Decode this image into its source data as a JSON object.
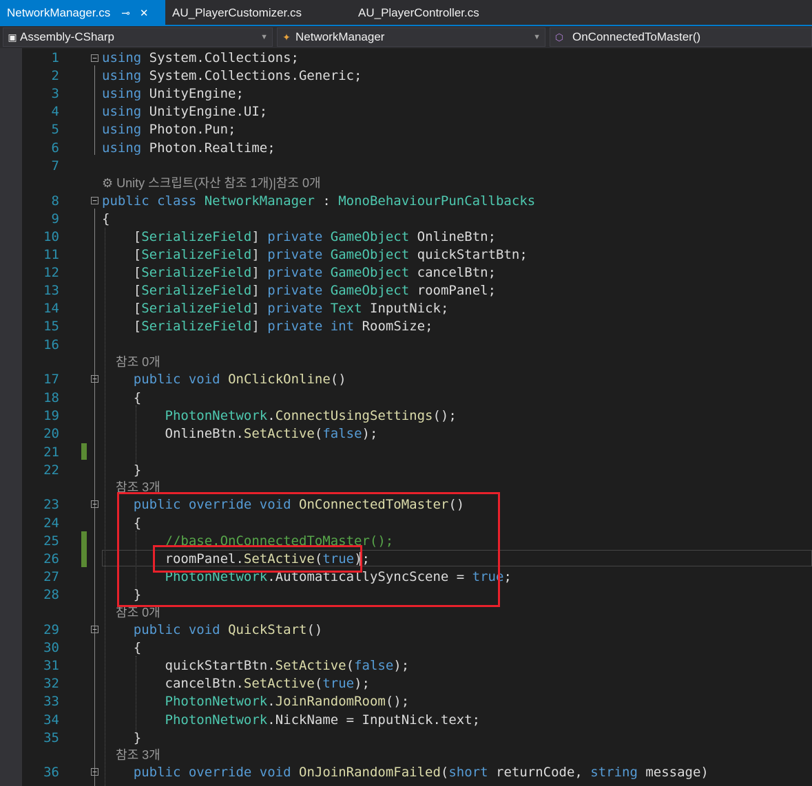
{
  "tabs": [
    {
      "label": "NetworkManager.cs",
      "active": true,
      "pin_icon": "pin-icon",
      "close_icon": "close-icon"
    },
    {
      "label": "AU_PlayerCustomizer.cs",
      "active": false
    },
    {
      "label": "AU_PlayerController.cs",
      "active": false
    }
  ],
  "navbar": {
    "project": {
      "label": "Assembly-CSharp",
      "icon": "csharp-project-icon"
    },
    "type": {
      "label": "NetworkManager",
      "icon": "class-icon"
    },
    "member": {
      "label": "OnConnectedToMaster()",
      "icon": "method-icon"
    }
  },
  "colors": {
    "background": "#1e1e1e",
    "keyword": "#569cd6",
    "type": "#4ec9b0",
    "method": "#dcdcaa",
    "comment": "#57a64a",
    "line_number": "#2b91af",
    "highlight_box": "#e8212b",
    "change_marker": "#5a8a33",
    "tab_active": "#007acc"
  },
  "code": {
    "l1": {
      "n": "1",
      "kw": "using",
      "rest": " System.Collections;"
    },
    "l2": {
      "n": "2",
      "kw": "using",
      "rest": " System.Collections.Generic;"
    },
    "l3": {
      "n": "3",
      "kw": "using",
      "rest": " UnityEngine;"
    },
    "l4": {
      "n": "4",
      "kw": "using",
      "rest": " UnityEngine.UI;"
    },
    "l5": {
      "n": "5",
      "kw": "using",
      "rest": " Photon.Pun;"
    },
    "l6": {
      "n": "6",
      "kw": "using",
      "rest": " Photon.Realtime;"
    },
    "l7": {
      "n": "7"
    },
    "lens8": {
      "icon": "unity-icon",
      "text": "Unity 스크립트(자산 참조 1개)|참조 0개"
    },
    "l8": {
      "n": "8",
      "kw": "public class",
      "name": "NetworkManager",
      "sep": " : ",
      "base": "MonoBehaviourPunCallbacks"
    },
    "l9": {
      "n": "9",
      "text": "{"
    },
    "l10": {
      "n": "10",
      "attr": "SerializeField",
      "mod": "private",
      "type": "GameObject",
      "name": "OnlineBtn;"
    },
    "l11": {
      "n": "11",
      "attr": "SerializeField",
      "mod": "private",
      "type": "GameObject",
      "name": "quickStartBtn;"
    },
    "l12": {
      "n": "12",
      "attr": "SerializeField",
      "mod": "private",
      "type": "GameObject",
      "name": "cancelBtn;"
    },
    "l13": {
      "n": "13",
      "attr": "SerializeField",
      "mod": "private",
      "type": "GameObject",
      "name": "roomPanel;"
    },
    "l14": {
      "n": "14",
      "attr": "SerializeField",
      "mod": "private",
      "type": "Text",
      "name": "InputNick;"
    },
    "l15": {
      "n": "15",
      "attr": "SerializeField",
      "mod": "private",
      "type": "int",
      "name": "RoomSize;"
    },
    "l16": {
      "n": "16"
    },
    "lens17": {
      "text": "참조 0개"
    },
    "l17": {
      "n": "17",
      "kw": "public void",
      "method": "OnClickOnline",
      "tail": "()"
    },
    "l18": {
      "n": "18",
      "text": "{"
    },
    "l19": {
      "n": "19",
      "type": "PhotonNetwork",
      "dot": ".",
      "method": "ConnectUsingSettings",
      "tail": "();"
    },
    "l20": {
      "n": "20",
      "obj": "OnlineBtn.",
      "method": "SetActive",
      "open": "(",
      "val": "false",
      "close": ");"
    },
    "l21": {
      "n": "21"
    },
    "l22": {
      "n": "22",
      "text": "}"
    },
    "lens23": {
      "text": "참조 3개"
    },
    "l23": {
      "n": "23",
      "kw": "public override void",
      "method": "OnConnectedToMaster",
      "tail": "()"
    },
    "l24": {
      "n": "24",
      "text": "{"
    },
    "l25": {
      "n": "25",
      "comment": "//base.OnConnectedToMaster();"
    },
    "l26": {
      "n": "26",
      "obj": "roomPanel.",
      "method": "SetActive",
      "open": "(",
      "val": "true",
      "close": ");"
    },
    "l27": {
      "n": "27",
      "type": "PhotonNetwork",
      "dot": ".",
      "member": "AutomaticallySyncScene = ",
      "val": "true",
      "tail": ";"
    },
    "l28": {
      "n": "28",
      "text": "}"
    },
    "lens29": {
      "text": "참조 0개"
    },
    "l29": {
      "n": "29",
      "kw": "public void",
      "method": "QuickStart",
      "tail": "()"
    },
    "l30": {
      "n": "30",
      "text": "{"
    },
    "l31": {
      "n": "31",
      "obj": "quickStartBtn.",
      "method": "SetActive",
      "open": "(",
      "val": "false",
      "close": ");"
    },
    "l32": {
      "n": "32",
      "obj": "cancelBtn.",
      "method": "SetActive",
      "open": "(",
      "val": "true",
      "close": ");"
    },
    "l33": {
      "n": "33",
      "type": "PhotonNetwork",
      "dot": ".",
      "method": "JoinRandomRoom",
      "tail": "();"
    },
    "l34": {
      "n": "34",
      "type": "PhotonNetwork",
      "dot": ".",
      "member": "NickName = InputNick.text;"
    },
    "l35": {
      "n": "35",
      "text": "}"
    },
    "lens36": {
      "text": "참조 3개"
    },
    "l36": {
      "n": "36",
      "kw": "public override void",
      "method": "OnJoinRandomFailed",
      "open": "(",
      "t1": "short",
      "p1": " returnCode, ",
      "t2": "string",
      "p2": " message)"
    }
  }
}
